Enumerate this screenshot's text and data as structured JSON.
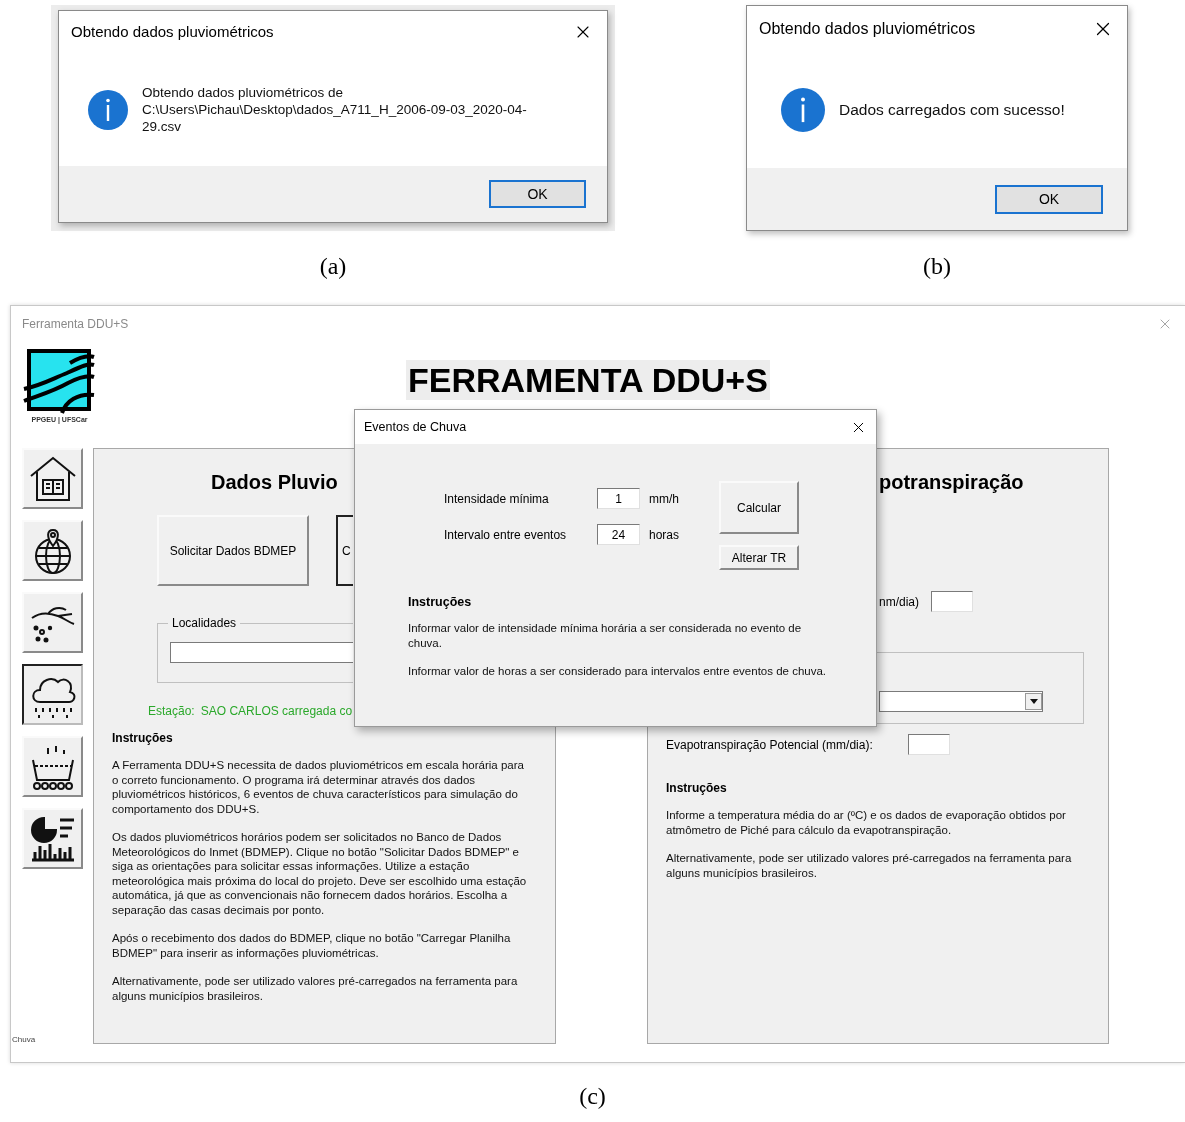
{
  "figure_a": {
    "title": "Obtendo dados pluviométricos",
    "message_lines": [
      "Obtendo dados pluviométricos de",
      "C:\\Users\\Pichau\\Desktop\\dados_A711_H_2006-09-03_2020-04-",
      "29.csv"
    ],
    "button": "OK",
    "caption": "(a)"
  },
  "figure_b": {
    "title": "Obtendo dados pluviométricos",
    "message_lines": [
      "Dados carregados com sucesso!"
    ],
    "button": "OK",
    "caption": "(b)"
  },
  "app": {
    "window_title": "Ferramenta DDU+S",
    "logo_text": "PPGEU | UFSCar",
    "heading": "FERRAMENTA DDU+S",
    "nav": [
      {
        "kind": "house",
        "selected": false
      },
      {
        "kind": "globe",
        "selected": false
      },
      {
        "kind": "hand",
        "selected": false
      },
      {
        "kind": "rain",
        "selected": true
      },
      {
        "kind": "basin",
        "selected": false
      },
      {
        "kind": "chart",
        "selected": false
      }
    ],
    "rain_panel": {
      "heading": "Dados Pluvio",
      "buttons": [
        "Solicitar Dados BDMEP",
        "C"
      ],
      "group_label": "Localidades",
      "station_label": "Estação:",
      "station_value": "SAO CARLOS carregada co",
      "instructions_title": "Instruções",
      "paragraphs": [
        "A Ferramenta DDU+S necessita de dados pluviométricos em escala horária para o correto funcionamento. O programa irá determinar através dos dados pluviométricos históricos, 6 eventos de chuva característicos para simulação do comportamento dos DDU+S.",
        "Os dados pluviométricos horários podem ser solicitados no Banco de Dados Meteorológicos do Inmet (BDMEP). Clique no botão \"Solicitar Dados BDMEP\" e siga as orientações para solicitar essas informações. Utilize a estação meteorológica mais próxima do local do projeto. Deve ser escolhido uma estação automática, já que as convencionais não fornecem dados horários. Escolha a separação das casas decimais por ponto.",
        "Após o recebimento dos dados do BDMEP, clique no botão \"Carregar Planilha BDMEP\" para inserir as informações pluviométricas.",
        "Alternativamente, pode ser utilizado valores pré-carregados na ferramenta para alguns municípios brasileiros."
      ]
    },
    "evapo_panel": {
      "heading": "potranspiração",
      "field_label": "nm/dia)",
      "potential_label": "Evapotranspiração Potencial  (mm/dia):",
      "instructions_title": "Instruções",
      "paragraphs": [
        "Informe a temperatura média do ar (ºC) e os dados de evaporação obtidos por atmômetro de Piché para cálculo da evapotranspiração.",
        "Alternativamente, pode ser utilizado valores pré-carregados na ferramenta para alguns municípios brasileiros."
      ]
    },
    "dialog": {
      "title": "Eventos de Chuva",
      "fields": [
        {
          "label": "Intensidade mínima",
          "value": "1",
          "unit": "mm/h"
        },
        {
          "label": "Intervalo entre eventos",
          "value": "24",
          "unit": "horas"
        }
      ],
      "buttons": [
        "Calcular",
        "Alterar TR"
      ],
      "instructions_title": "Instruções",
      "paragraphs": [
        "Informar valor de intensidade mínima horária a ser considerada no evento de chuva.",
        "Informar valor de horas a ser considerado para intervalos entre eventos de chuva."
      ]
    },
    "status_bar": "Chuva"
  },
  "caption_c": "(c)"
}
